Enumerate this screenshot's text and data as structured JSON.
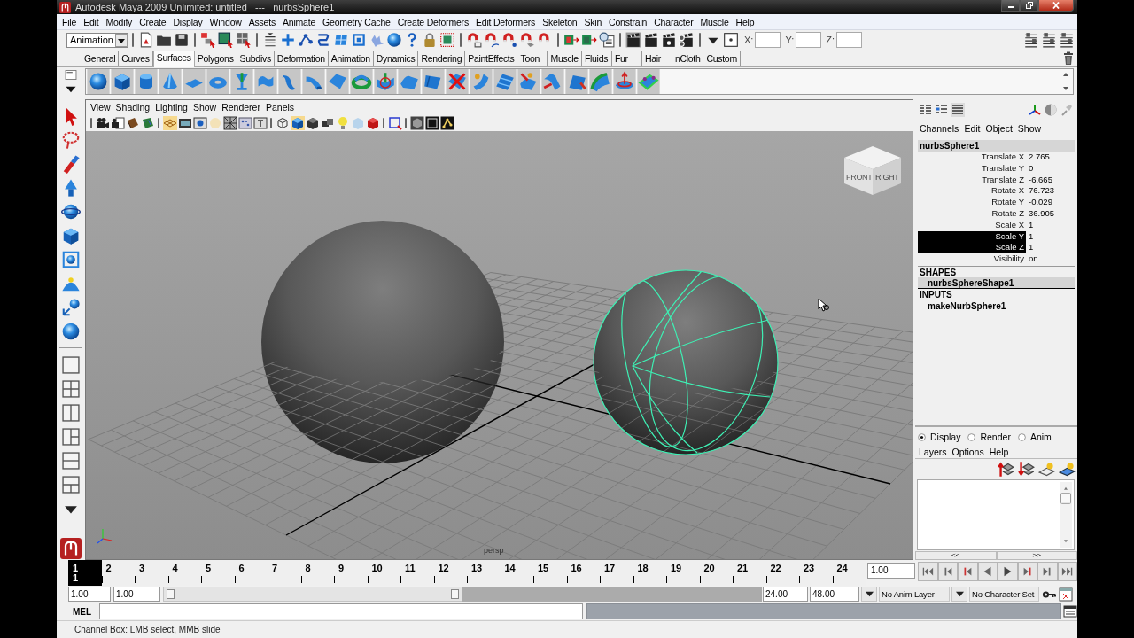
{
  "window": {
    "title": "Autodesk Maya 2009 Unlimited: untitled   ---   nurbsSphere1"
  },
  "menu_bar": [
    "File",
    "Edit",
    "Modify",
    "Create",
    "Display",
    "Window",
    "Assets",
    "Animate",
    "Geometry Cache",
    "Create Deformers",
    "Edit Deformers",
    "Skeleton",
    "Skin",
    "Constrain",
    "Character",
    "Muscle",
    "Help"
  ],
  "status_line": {
    "menu_set": "Animation",
    "fields": [
      {
        "label": "X:"
      },
      {
        "label": "Y:"
      },
      {
        "label": "Z:"
      }
    ]
  },
  "shelf": {
    "tabs": [
      {
        "label": "General",
        "selected": false
      },
      {
        "label": "Curves",
        "selected": false
      },
      {
        "label": "Surfaces",
        "selected": true
      },
      {
        "label": "Polygons",
        "selected": false
      },
      {
        "label": "Subdivs",
        "selected": false
      },
      {
        "label": "Deformation",
        "selected": false
      },
      {
        "label": "Animation",
        "selected": false
      },
      {
        "label": "Dynamics",
        "selected": false
      },
      {
        "label": "Rendering",
        "selected": false
      },
      {
        "label": "PaintEffects",
        "selected": false
      },
      {
        "label": "Toon",
        "selected": false
      },
      {
        "label": "Muscle",
        "selected": false
      },
      {
        "label": "Fluids",
        "selected": false
      },
      {
        "label": "Fur",
        "selected": false
      },
      {
        "label": "Hair",
        "selected": false
      },
      {
        "label": "nCloth",
        "selected": false
      },
      {
        "label": "Custom",
        "selected": false
      }
    ]
  },
  "viewport": {
    "menu": [
      "View",
      "Shading",
      "Lighting",
      "Show",
      "Renderer",
      "Panels"
    ],
    "view_cube": [
      "FRONT",
      "RIGHT"
    ],
    "camera": "persp"
  },
  "channel_box": {
    "menu": [
      "Channels",
      "Edit",
      "Object",
      "Show"
    ],
    "object": "nurbsSphere1",
    "attributes": [
      {
        "name": "Translate X",
        "value": "2.765",
        "selected": false
      },
      {
        "name": "Translate Y",
        "value": "0",
        "selected": false
      },
      {
        "name": "Translate Z",
        "value": "-6.665",
        "selected": false
      },
      {
        "name": "Rotate X",
        "value": "76.723",
        "selected": false
      },
      {
        "name": "Rotate Y",
        "value": "-0.029",
        "selected": false
      },
      {
        "name": "Rotate Z",
        "value": "36.905",
        "selected": false
      },
      {
        "name": "Scale X",
        "value": "1",
        "selected": false
      },
      {
        "name": "Scale Y",
        "value": "1",
        "selected": true
      },
      {
        "name": "Scale Z",
        "value": "1",
        "selected": true
      },
      {
        "name": "Visibility",
        "value": "on",
        "selected": false
      }
    ],
    "sections": [
      {
        "heading": "SHAPES",
        "items": [
          {
            "name": "nurbsSphereShape1",
            "selected": true
          }
        ]
      },
      {
        "heading": "INPUTS",
        "items": [
          {
            "name": "makeNurbSphere1",
            "selected": false
          }
        ]
      }
    ]
  },
  "layer_editor": {
    "modes": [
      {
        "label": "Display",
        "selected": true
      },
      {
        "label": "Render",
        "selected": false
      },
      {
        "label": "Anim",
        "selected": false
      }
    ],
    "menu": [
      "Layers",
      "Options",
      "Help"
    ],
    "paging": [
      "<<",
      ">>"
    ]
  },
  "time_slider": {
    "frames": [
      {
        "label": "1",
        "selected": true
      },
      {
        "label": "2",
        "selected": false
      },
      {
        "label": "3",
        "selected": false
      },
      {
        "label": "4",
        "selected": false
      },
      {
        "label": "5",
        "selected": false
      },
      {
        "label": "6",
        "selected": false
      },
      {
        "label": "7",
        "selected": false
      },
      {
        "label": "8",
        "selected": false
      },
      {
        "label": "9",
        "selected": false
      },
      {
        "label": "10",
        "selected": false
      },
      {
        "label": "11",
        "selected": false
      },
      {
        "label": "12",
        "selected": false
      },
      {
        "label": "13",
        "selected": false
      },
      {
        "label": "14",
        "selected": false
      },
      {
        "label": "15",
        "selected": false
      },
      {
        "label": "16",
        "selected": false
      },
      {
        "label": "17",
        "selected": false
      },
      {
        "label": "18",
        "selected": false
      },
      {
        "label": "19",
        "selected": false
      },
      {
        "label": "20",
        "selected": false
      },
      {
        "label": "21",
        "selected": false
      },
      {
        "label": "22",
        "selected": false
      },
      {
        "label": "23",
        "selected": false
      },
      {
        "label": "24",
        "selected": false
      }
    ],
    "current_frame": "1",
    "current_time": "1.00"
  },
  "range_slider": {
    "start_time": "1.00",
    "playback_start": "1.00",
    "level": 0.5,
    "playback_end": "24.00",
    "end_time": "48.00",
    "anim_layer": "No Anim Layer",
    "character_set": "No Character Set"
  },
  "command_line": {
    "language": "MEL"
  },
  "help_line": "Channel Box: LMB select, MMB slide"
}
